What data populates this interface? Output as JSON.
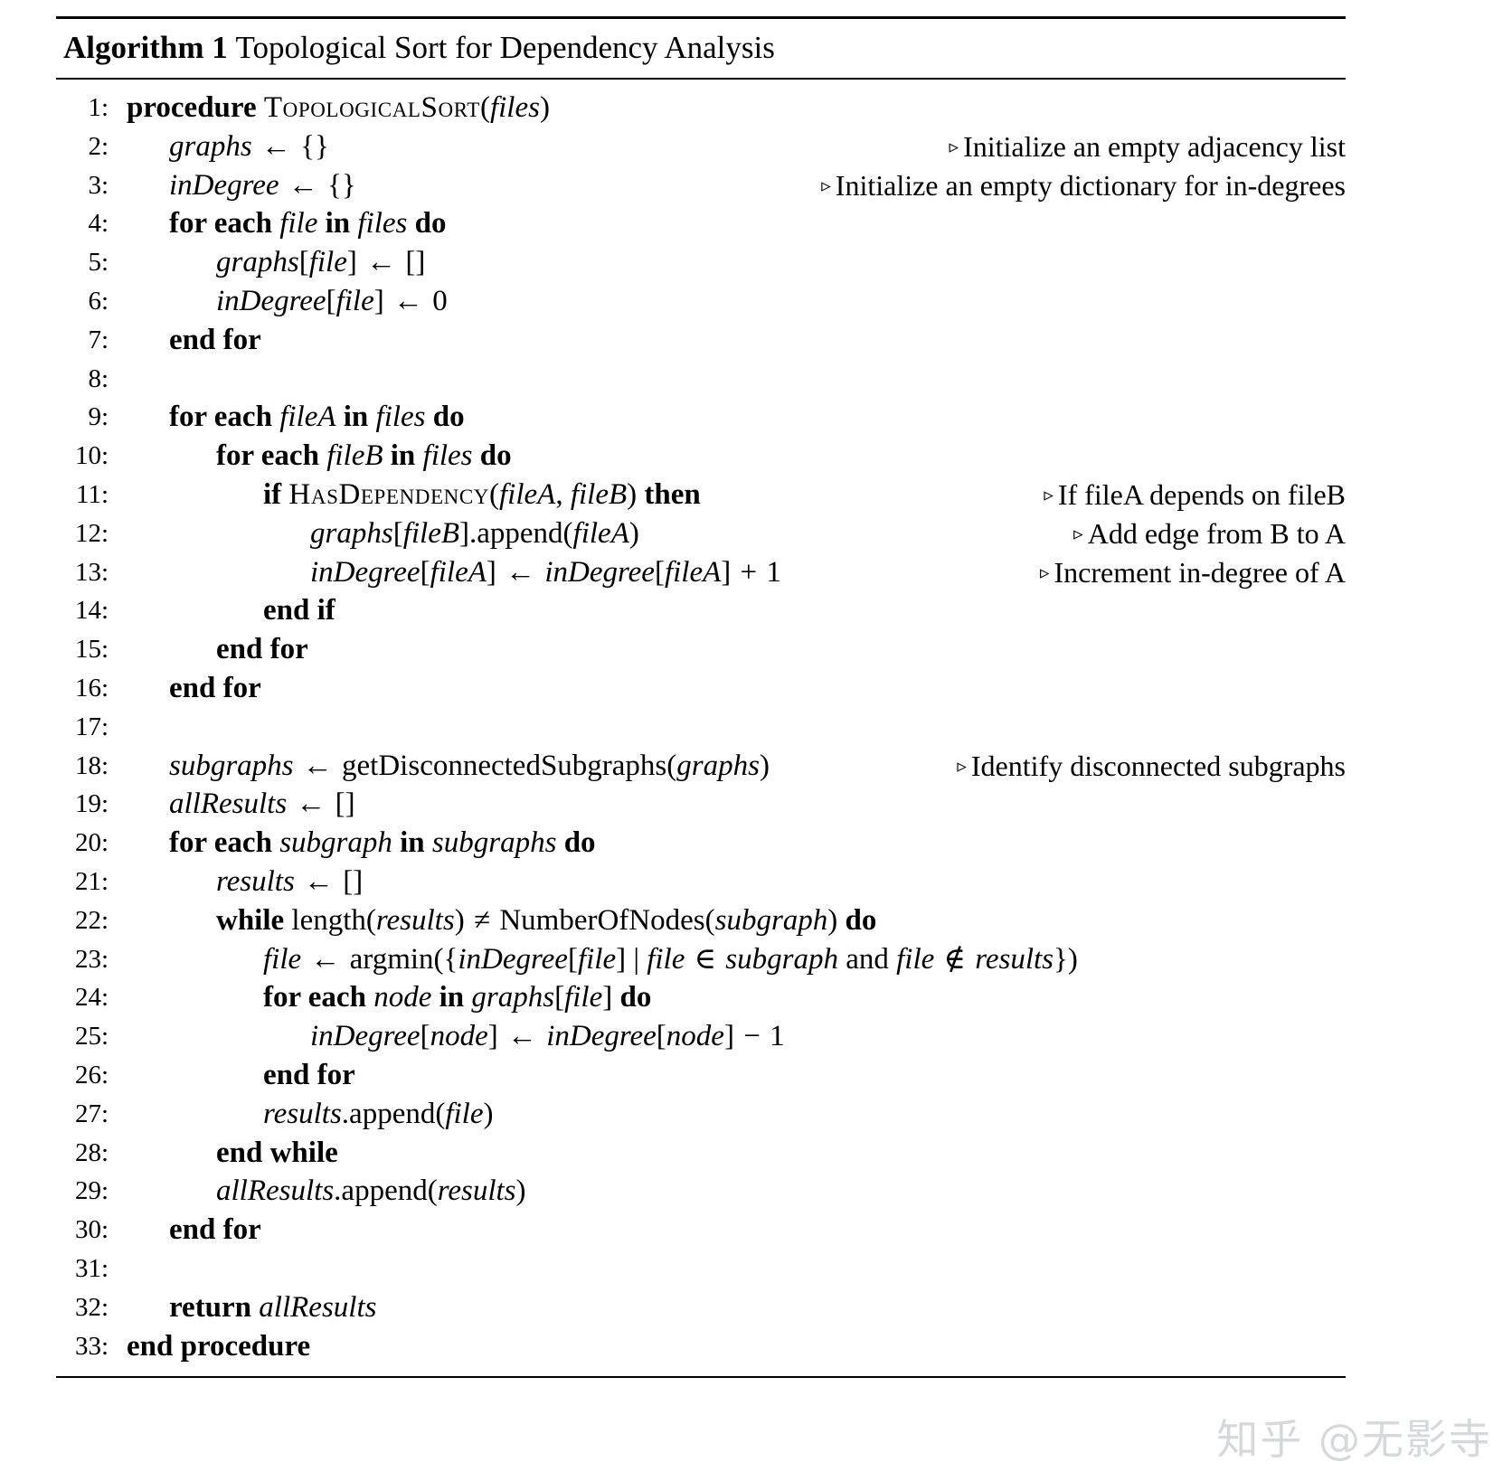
{
  "document": {
    "type": "algorithm-pseudocode",
    "title_label": "Algorithm 1",
    "title_text": "Topological Sort for Dependency Analysis",
    "comment_marker": "▹",
    "watermark": "知乎 @无影寺",
    "watermark_color": "#d6d8da",
    "text_color": "#000000",
    "background_color": "#ffffff"
  },
  "lines": [
    {
      "no": "1:",
      "code": "procedure TopologicalSort(files)",
      "comment": ""
    },
    {
      "no": "2:",
      "code": "graphs ← {}",
      "comment": "Initialize an empty adjacency list"
    },
    {
      "no": "3:",
      "code": "inDegree ← {}",
      "comment": "Initialize an empty dictionary for in-degrees"
    },
    {
      "no": "4:",
      "code": "for each file in files do",
      "comment": ""
    },
    {
      "no": "5:",
      "code": "graphs[file] ← []",
      "comment": ""
    },
    {
      "no": "6:",
      "code": "inDegree[file] ← 0",
      "comment": ""
    },
    {
      "no": "7:",
      "code": "end for",
      "comment": ""
    },
    {
      "no": "8:",
      "code": "",
      "comment": ""
    },
    {
      "no": "9:",
      "code": "for each fileA in files do",
      "comment": ""
    },
    {
      "no": "10:",
      "code": "for each fileB in files do",
      "comment": ""
    },
    {
      "no": "11:",
      "code": "if HasDependency(fileA, fileB) then",
      "comment": "If fileA depends on fileB"
    },
    {
      "no": "12:",
      "code": "graphs[fileB].append(fileA)",
      "comment": "Add edge from B to A"
    },
    {
      "no": "13:",
      "code": "inDegree[fileA] ← inDegree[fileA] + 1",
      "comment": "Increment in-degree of A"
    },
    {
      "no": "14:",
      "code": "end if",
      "comment": ""
    },
    {
      "no": "15:",
      "code": "end for",
      "comment": ""
    },
    {
      "no": "16:",
      "code": "end for",
      "comment": ""
    },
    {
      "no": "17:",
      "code": "",
      "comment": ""
    },
    {
      "no": "18:",
      "code": "subgraphs ← getDisconnectedSubgraphs(graphs)",
      "comment": "Identify disconnected subgraphs"
    },
    {
      "no": "19:",
      "code": "allResults ← []",
      "comment": ""
    },
    {
      "no": "20:",
      "code": "for each subgraph in subgraphs do",
      "comment": ""
    },
    {
      "no": "21:",
      "code": "results ← []",
      "comment": ""
    },
    {
      "no": "22:",
      "code": "while length(results) ≠ NumberOfNodes(subgraph) do",
      "comment": ""
    },
    {
      "no": "23:",
      "code": "file ← argmin({inDegree[file] | file ∈ subgraph and file ∉ results})",
      "comment": ""
    },
    {
      "no": "24:",
      "code": "for each node in graphs[file] do",
      "comment": ""
    },
    {
      "no": "25:",
      "code": "inDegree[node] ← inDegree[node] − 1",
      "comment": ""
    },
    {
      "no": "26:",
      "code": "end for",
      "comment": ""
    },
    {
      "no": "27:",
      "code": "results.append(file)",
      "comment": ""
    },
    {
      "no": "28:",
      "code": "end while",
      "comment": ""
    },
    {
      "no": "29:",
      "code": "allResults.append(results)",
      "comment": ""
    },
    {
      "no": "30:",
      "code": "end for",
      "comment": ""
    },
    {
      "no": "31:",
      "code": "",
      "comment": ""
    },
    {
      "no": "32:",
      "code": "return allResults",
      "comment": ""
    },
    {
      "no": "33:",
      "code": "end procedure",
      "comment": ""
    }
  ]
}
